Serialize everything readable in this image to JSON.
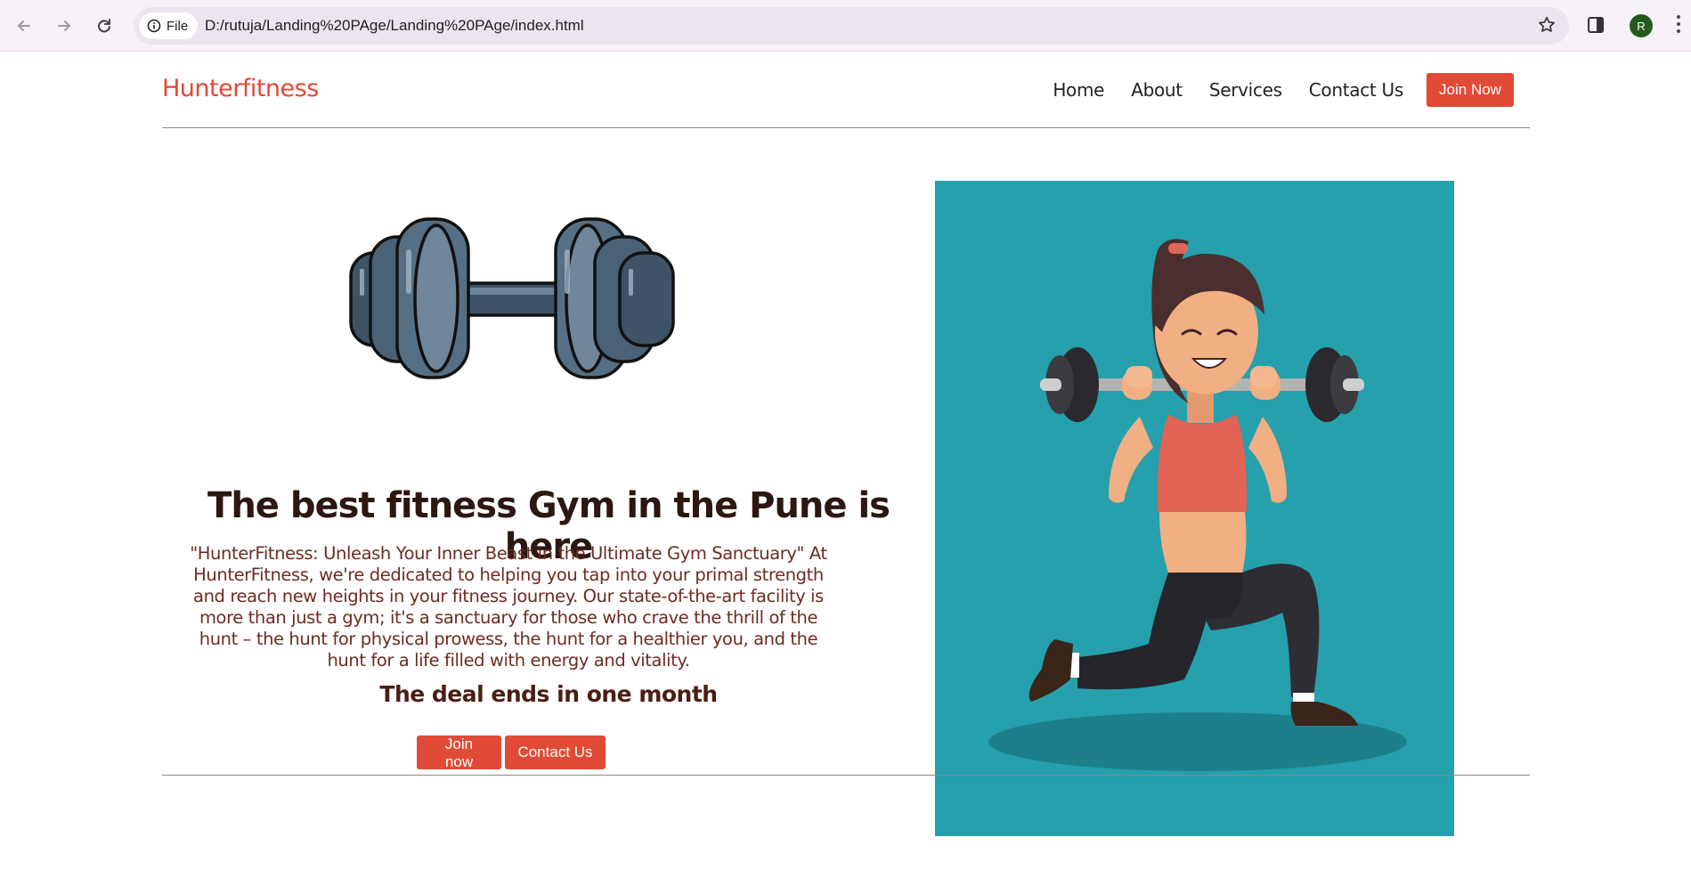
{
  "browser": {
    "site_chip_label": "File",
    "url": "D:/rutuja/Landing%20PAge/Landing%20PAge/index.html",
    "profile_initial": "R"
  },
  "navbar": {
    "brand": "Hunterfitness",
    "links": [
      "Home",
      "About",
      "Services",
      "Contact Us"
    ],
    "cta": "Join Now"
  },
  "hero": {
    "headline": "The best fitness Gym in the Pune is here",
    "description": "\"HunterFitness: Unleash Your Inner Beast in the Ultimate Gym Sanctuary\" At HunterFitness, we're dedicated to helping you tap into your primal strength and reach new heights in your fitness journey. Our state-of-the-art facility is more than just a gym; it's a sanctuary for those who crave the thrill of the hunt – the hunt for physical prowess, the hunt for a healthier you, and the hunt for a life filled with energy and vitality.",
    "deal": "The deal ends in one month",
    "buttons": {
      "join": "Join now",
      "contact": "Contact Us"
    }
  },
  "colors": {
    "brand_red": "#e04a36",
    "hero_teal": "#25a0ac"
  },
  "icons": [
    "back-icon",
    "forward-icon",
    "reload-icon",
    "info-icon",
    "star-icon",
    "side-panel-icon",
    "menu-dots-icon"
  ]
}
